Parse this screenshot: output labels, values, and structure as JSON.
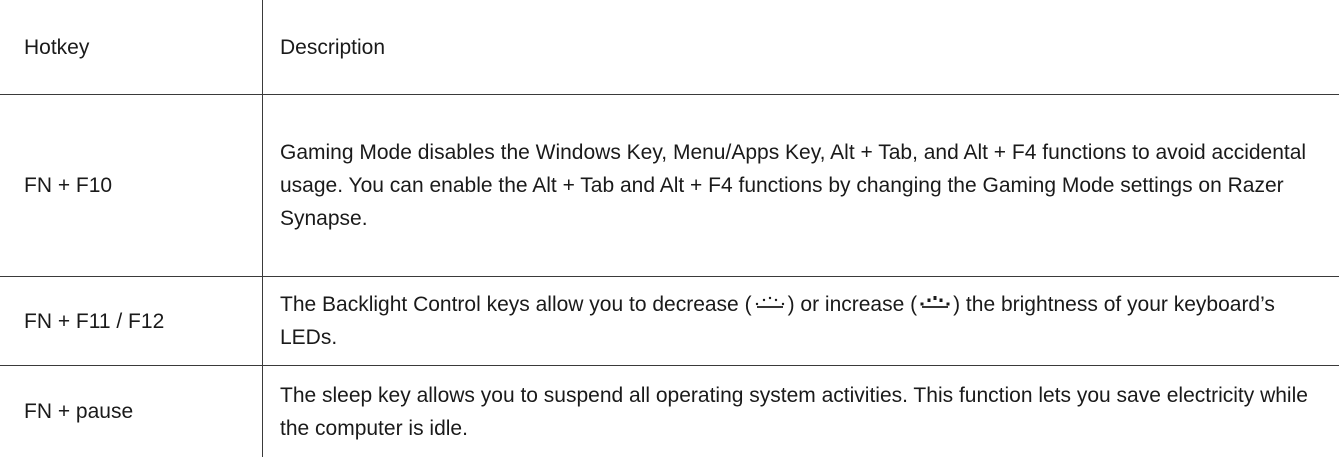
{
  "table": {
    "headers": {
      "hotkey": "Hotkey",
      "description": "Description"
    },
    "rows": [
      {
        "hotkey": "FN + F10",
        "description": "Gaming Mode disables the Windows Key, Menu/Apps Key, Alt + Tab, and Alt + F4 functions to avoid accidental usage. You can enable the Alt + Tab and Alt + F4 functions by changing the Gaming Mode settings on Razer Synapse."
      },
      {
        "hotkey": "FN + F11 / F12",
        "description_part1": "The Backlight Control keys allow you to decrease (",
        "description_part2": ") or increase (",
        "description_part3": ") the brightness of your keyboard’s LEDs.",
        "icons": [
          "brightness-decrease-icon",
          "brightness-increase-icon"
        ]
      },
      {
        "hotkey": "FN + pause",
        "description": "The sleep key allows you to suspend all operating system activities. This function lets you save electricity while the computer is idle."
      }
    ]
  },
  "colors": {
    "text": "#1a1a1a",
    "rule": "#3a3a3a",
    "background": "#ffffff"
  }
}
